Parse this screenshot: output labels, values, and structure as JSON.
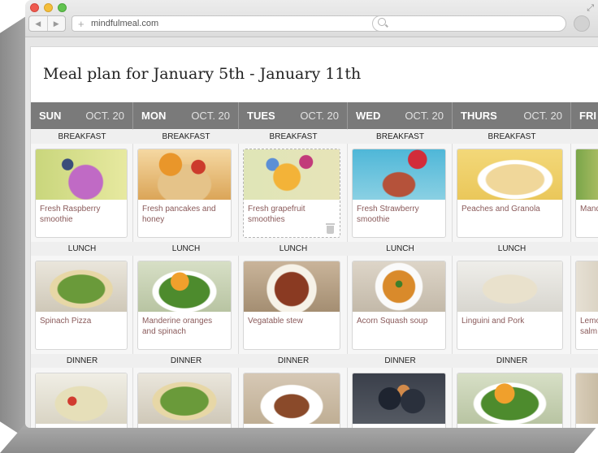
{
  "browser": {
    "url": "mindfulmeal.com",
    "search_placeholder": ""
  },
  "page": {
    "title": "Meal plan for January 5th - January 11th"
  },
  "days": [
    {
      "name": "SUN",
      "date": "OCT. 20"
    },
    {
      "name": "MON",
      "date": "OCT. 20"
    },
    {
      "name": "TUES",
      "date": "OCT. 20"
    },
    {
      "name": "WED",
      "date": "OCT. 20"
    },
    {
      "name": "THURS",
      "date": "OCT. 20"
    },
    {
      "name": "FRI",
      "date": ""
    }
  ],
  "meal_labels": {
    "breakfast": "BREAKFAST",
    "lunch": "LUNCH",
    "dinner": "DINNER"
  },
  "breakfast": [
    {
      "name": "Fresh Raspberry smoothie"
    },
    {
      "name": "Fresh pancakes and honey"
    },
    {
      "name": "Fresh grapefruit smoothies"
    },
    {
      "name": "Fresh Strawberry smoothie"
    },
    {
      "name": "Peaches and Granola"
    },
    {
      "name": "Mand"
    }
  ],
  "lunch": [
    {
      "name": "Spinach Pizza"
    },
    {
      "name": "Manderine oranges and spinach"
    },
    {
      "name": "Vegatable stew"
    },
    {
      "name": "Acorn Squash soup"
    },
    {
      "name": "Linguini and Pork"
    },
    {
      "name": "Lemo salm"
    }
  ],
  "dinner": [
    {
      "name": ""
    },
    {
      "name": ""
    },
    {
      "name": ""
    },
    {
      "name": ""
    },
    {
      "name": ""
    },
    {
      "name": ""
    }
  ]
}
